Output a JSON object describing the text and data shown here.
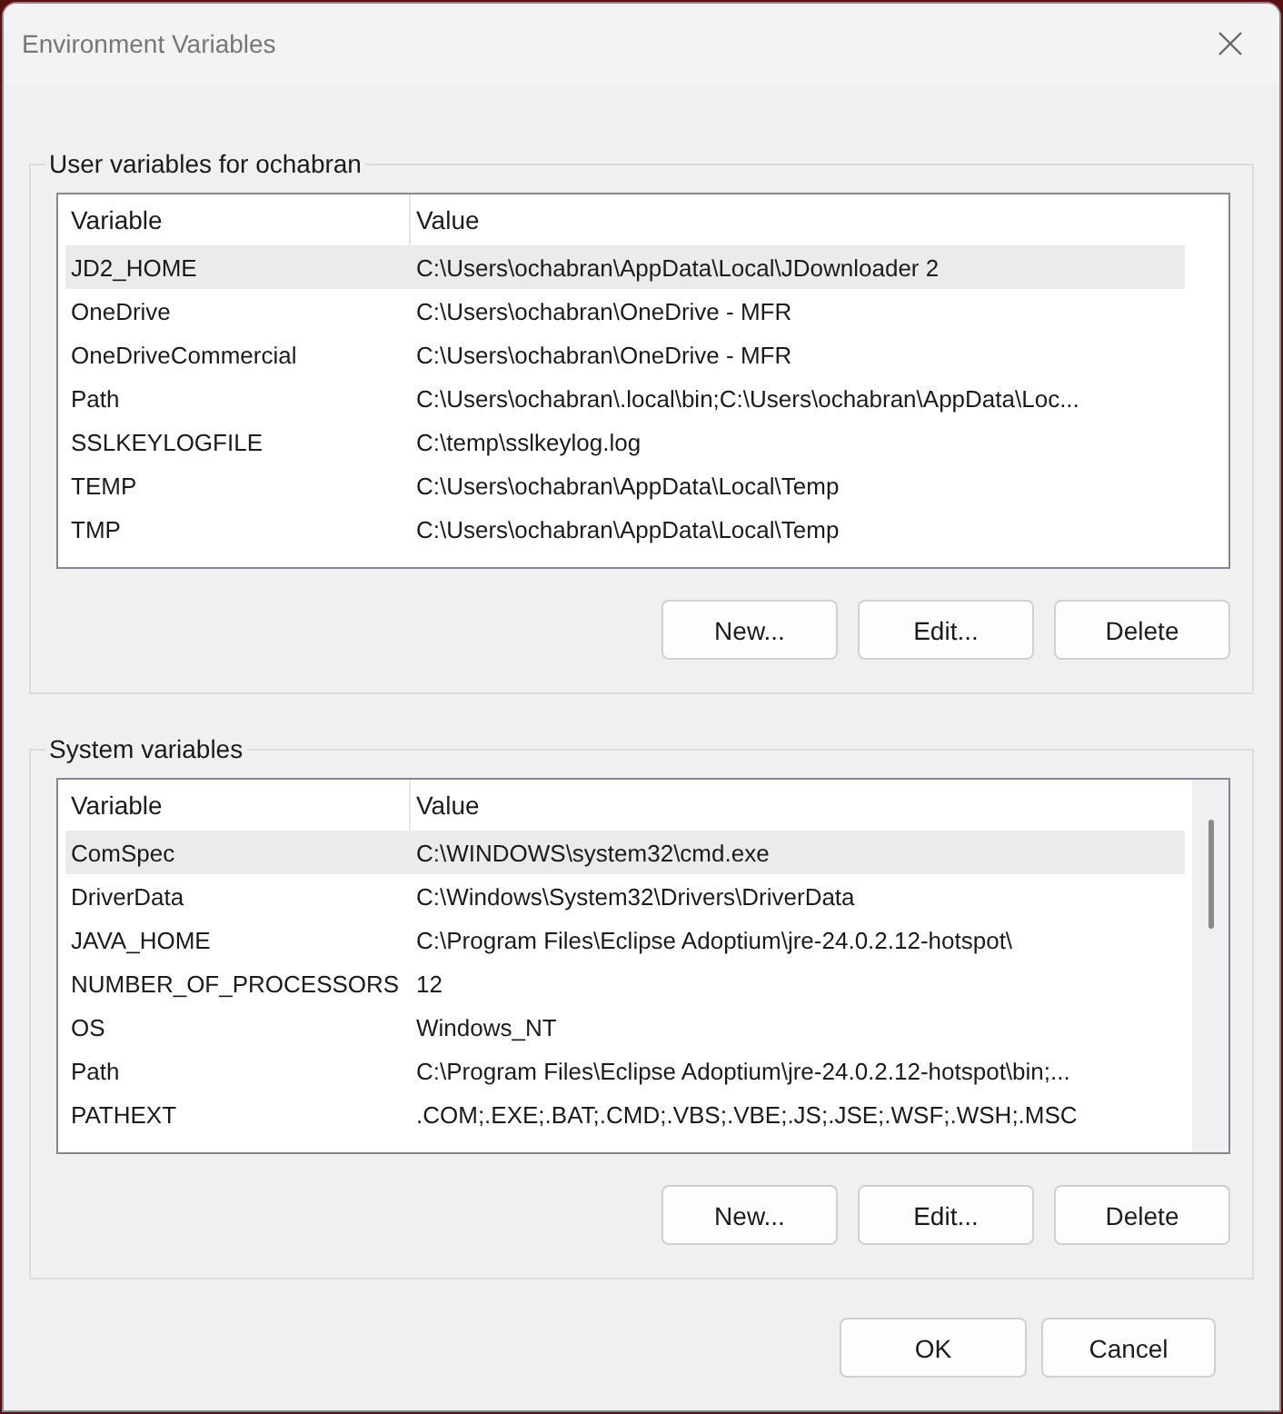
{
  "window": {
    "title": "Environment Variables"
  },
  "groups": [
    {
      "title": "User variables for ochabran",
      "columns": [
        "Variable",
        "Value"
      ],
      "scrollbar": false,
      "rows": [
        {
          "variable": "JD2_HOME",
          "value": "C:\\Users\\ochabran\\AppData\\Local\\JDownloader 2",
          "selected": true
        },
        {
          "variable": "OneDrive",
          "value": "C:\\Users\\ochabran\\OneDrive - MFR",
          "selected": false
        },
        {
          "variable": "OneDriveCommercial",
          "value": "C:\\Users\\ochabran\\OneDrive - MFR",
          "selected": false
        },
        {
          "variable": "Path",
          "value": "C:\\Users\\ochabran\\.local\\bin;C:\\Users\\ochabran\\AppData\\Loc...",
          "selected": false
        },
        {
          "variable": "SSLKEYLOGFILE",
          "value": "C:\\temp\\sslkeylog.log",
          "selected": false
        },
        {
          "variable": "TEMP",
          "value": "C:\\Users\\ochabran\\AppData\\Local\\Temp",
          "selected": false
        },
        {
          "variable": "TMP",
          "value": "C:\\Users\\ochabran\\AppData\\Local\\Temp",
          "selected": false
        }
      ],
      "buttons": [
        "New...",
        "Edit...",
        "Delete"
      ]
    },
    {
      "title": "System variables",
      "columns": [
        "Variable",
        "Value"
      ],
      "scrollbar": true,
      "rows": [
        {
          "variable": "ComSpec",
          "value": "C:\\WINDOWS\\system32\\cmd.exe",
          "selected": true
        },
        {
          "variable": "DriverData",
          "value": "C:\\Windows\\System32\\Drivers\\DriverData",
          "selected": false
        },
        {
          "variable": "JAVA_HOME",
          "value": "C:\\Program Files\\Eclipse Adoptium\\jre-24.0.2.12-hotspot\\",
          "selected": false
        },
        {
          "variable": "NUMBER_OF_PROCESSORS",
          "value": "12",
          "selected": false
        },
        {
          "variable": "OS",
          "value": "Windows_NT",
          "selected": false
        },
        {
          "variable": "Path",
          "value": "C:\\Program Files\\Eclipse Adoptium\\jre-24.0.2.12-hotspot\\bin;...",
          "selected": false
        },
        {
          "variable": "PATHEXT",
          "value": ".COM;.EXE;.BAT;.CMD;.VBS;.VBE;.JS;.JSE;.WSF;.WSH;.MSC",
          "selected": false
        }
      ],
      "buttons": [
        "New...",
        "Edit...",
        "Delete"
      ]
    }
  ],
  "buttons": [
    "OK",
    "Cancel"
  ]
}
